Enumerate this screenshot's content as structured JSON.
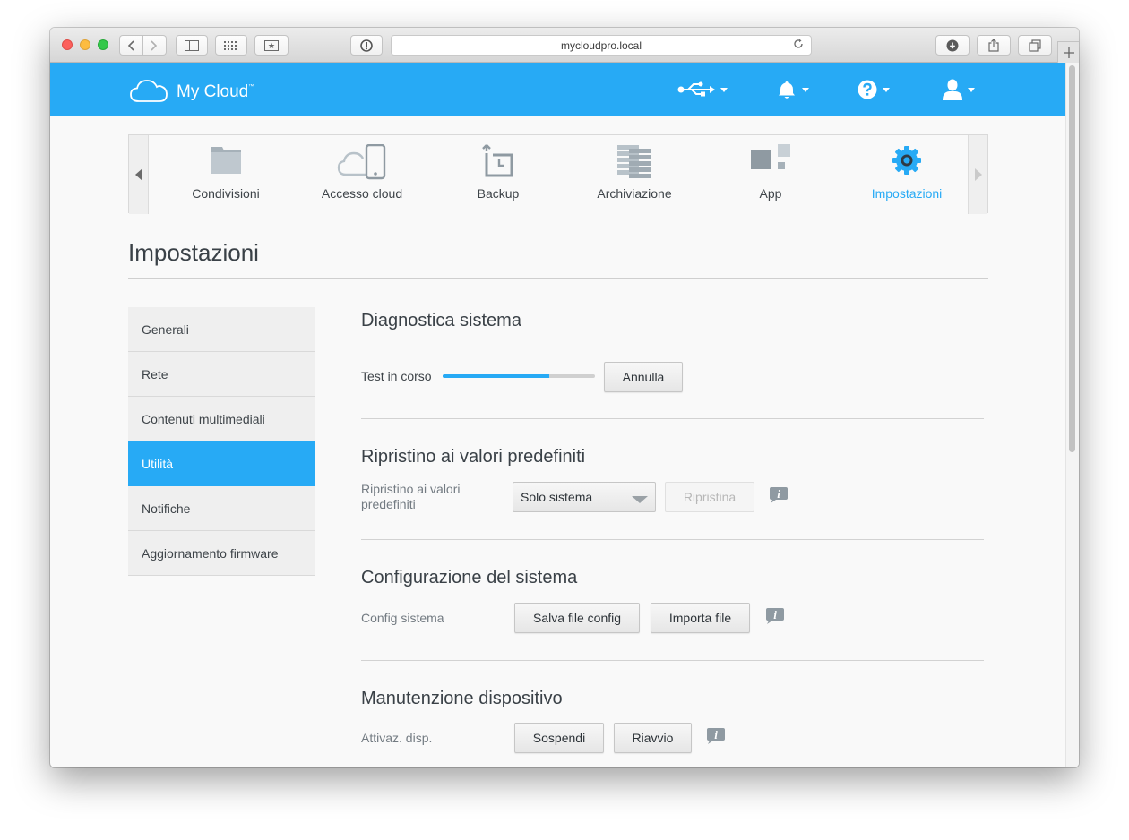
{
  "browser": {
    "url": "mycloudpro.local",
    "icons": [
      "back-icon",
      "forward-icon",
      "sidebar-icon",
      "grid-icon",
      "bookmark-icon",
      "info-icon",
      "reload-icon",
      "download-icon",
      "share-icon",
      "tabs-icon",
      "plus-icon"
    ]
  },
  "header": {
    "brand": "My Cloud",
    "trademark": "™",
    "icons": [
      "usb-icon",
      "bell-icon",
      "help-icon",
      "user-icon"
    ]
  },
  "nav": {
    "tabs": [
      {
        "label": "Condivisioni",
        "icon": "folder-icon"
      },
      {
        "label": "Accesso cloud",
        "icon": "cloud-device-icon"
      },
      {
        "label": "Backup",
        "icon": "backup-icon"
      },
      {
        "label": "Archiviazione",
        "icon": "storage-icon"
      },
      {
        "label": "App",
        "icon": "apps-icon"
      },
      {
        "label": "Impostazioni",
        "icon": "gear-icon",
        "active": true
      }
    ]
  },
  "page": {
    "title": "Impostazioni"
  },
  "sidebar": {
    "items": [
      {
        "label": "Generali"
      },
      {
        "label": "Rete"
      },
      {
        "label": "Contenuti multimediali"
      },
      {
        "label": "Utilità",
        "active": true
      },
      {
        "label": "Notifiche"
      },
      {
        "label": "Aggiornamento firmware"
      }
    ]
  },
  "diagnostics": {
    "title": "Diagnostica sistema",
    "status_label": "Test in corso",
    "progress": 0.7,
    "cancel_label": "Annulla"
  },
  "restore": {
    "title": "Ripristino ai valori predefiniti",
    "label_line1": "Ripristino ai valori",
    "label_line2": "predefiniti",
    "select_value": "Solo sistema",
    "restore_label": "Ripristina"
  },
  "config": {
    "title": "Configurazione del sistema",
    "label": "Config sistema",
    "save_label": "Salva file config",
    "import_label": "Importa file"
  },
  "maintenance": {
    "title": "Manutenzione dispositivo",
    "label": "Attivaz. disp.",
    "sleep_label": "Sospendi",
    "reboot_label": "Riavvio"
  },
  "colors": {
    "accent": "#27aaf5",
    "text_dark": "#3a4147",
    "text_muted": "#737b82"
  }
}
